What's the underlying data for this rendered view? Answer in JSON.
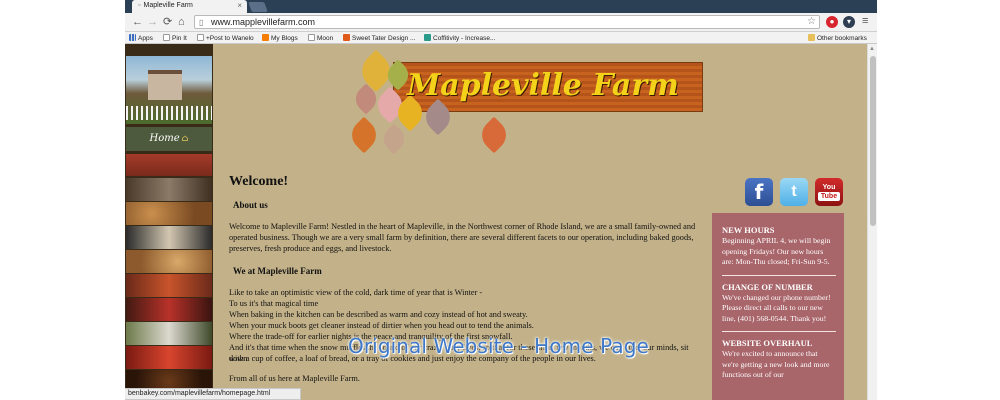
{
  "browser": {
    "tab_title": "Mapleville Farm",
    "tab_close": "×",
    "url": "www.mapplevillefarm.com",
    "status_url": "benbakey.com/maplevillefarm/homepage.html",
    "nav": {
      "back": "←",
      "forward": "→",
      "reload": "⟳",
      "home": "⌂",
      "star": "☆",
      "menu": "≡"
    },
    "bookmarks": [
      {
        "label": "Apps",
        "icon": "apps-icon",
        "color": "#4a4a4a"
      },
      {
        "label": "Pin It",
        "icon": "page-icon",
        "color": "#9a9a9a"
      },
      {
        "label": "+Post to Wanelo",
        "icon": "page-icon",
        "color": "#9a9a9a"
      },
      {
        "label": "My Blogs",
        "icon": "blogger-icon",
        "color": "#f57d00"
      },
      {
        "label": "Moon",
        "icon": "page-icon",
        "color": "#9a9a9a"
      },
      {
        "label": "Sweet Tater Design ...",
        "icon": "etsy-icon",
        "color": "#e05a1a"
      },
      {
        "label": "Coffitivity - Increase...",
        "icon": "coffitivity-icon",
        "color": "#2a9a8a"
      }
    ],
    "other_bookmarks": "Other bookmarks"
  },
  "sidebar": {
    "home_label": "Home"
  },
  "header": {
    "logo_text": "Mapleville Farm"
  },
  "main": {
    "welcome": "Welcome!",
    "about_heading": "About us",
    "about_text": "Welcome to Mapleville Farm! Nestled in the heart of Mapleville, in the Northwest corner of Rhode Island, we are a small family-owned and operated business. Though we are a very small farm by definition, there are several different facets to our operation, including baked goods, preserves, fresh produce and eggs, and livestock.",
    "we_heading": "We at Mapleville Farm",
    "lines": [
      "Like to take an optimistic view of the cold, dark time of year that is Winter -",
      "To us it's that magical time",
      "When baking in the kitchen can be described as warm and cozy instead of hot and sweaty.",
      "When your muck boots get cleaner instead of dirtier when you head out to tend the animals.",
      "Where the trade-off for earlier nights is the peace and tranquility of the first snowfall.",
      "And it's that time when the snow muffles the sound of our crazy, busy lives, so that for these short few months, we can quiet our minds, sit down",
      "with a cup of coffee, a loaf of bread, or a tray of cookies and just enjoy the company of the people in our lives."
    ],
    "closing": "From all of us here at Mapleville Farm."
  },
  "news": [
    {
      "heading": "NEW HOURS",
      "text": "Beginning APRIL 4, we will begin opening Fridays! Our new hours are: Mon-Thu closed; Fri-Sun 9-5."
    },
    {
      "heading": "CHANGE OF NUMBER",
      "text": "We've changed our phone number! Please direct all calls to our new line, (401) 568-0544. Thank you!"
    },
    {
      "heading": "WEBSITE OVERHAUL",
      "text": "We're excited to announce that we're getting a new look and more functions out of our"
    }
  ],
  "social": {
    "facebook": "f",
    "twitter": "t",
    "youtube_top": "You",
    "youtube_bottom": "Tube"
  },
  "overlay_caption": "Original Website - Home Page",
  "colors": {
    "page_bg": "#c3b289",
    "news_bg": "#a8656a",
    "logo_text": "#f5d21a",
    "logo_board": "#c8621f",
    "caption": "#3e78c8"
  }
}
